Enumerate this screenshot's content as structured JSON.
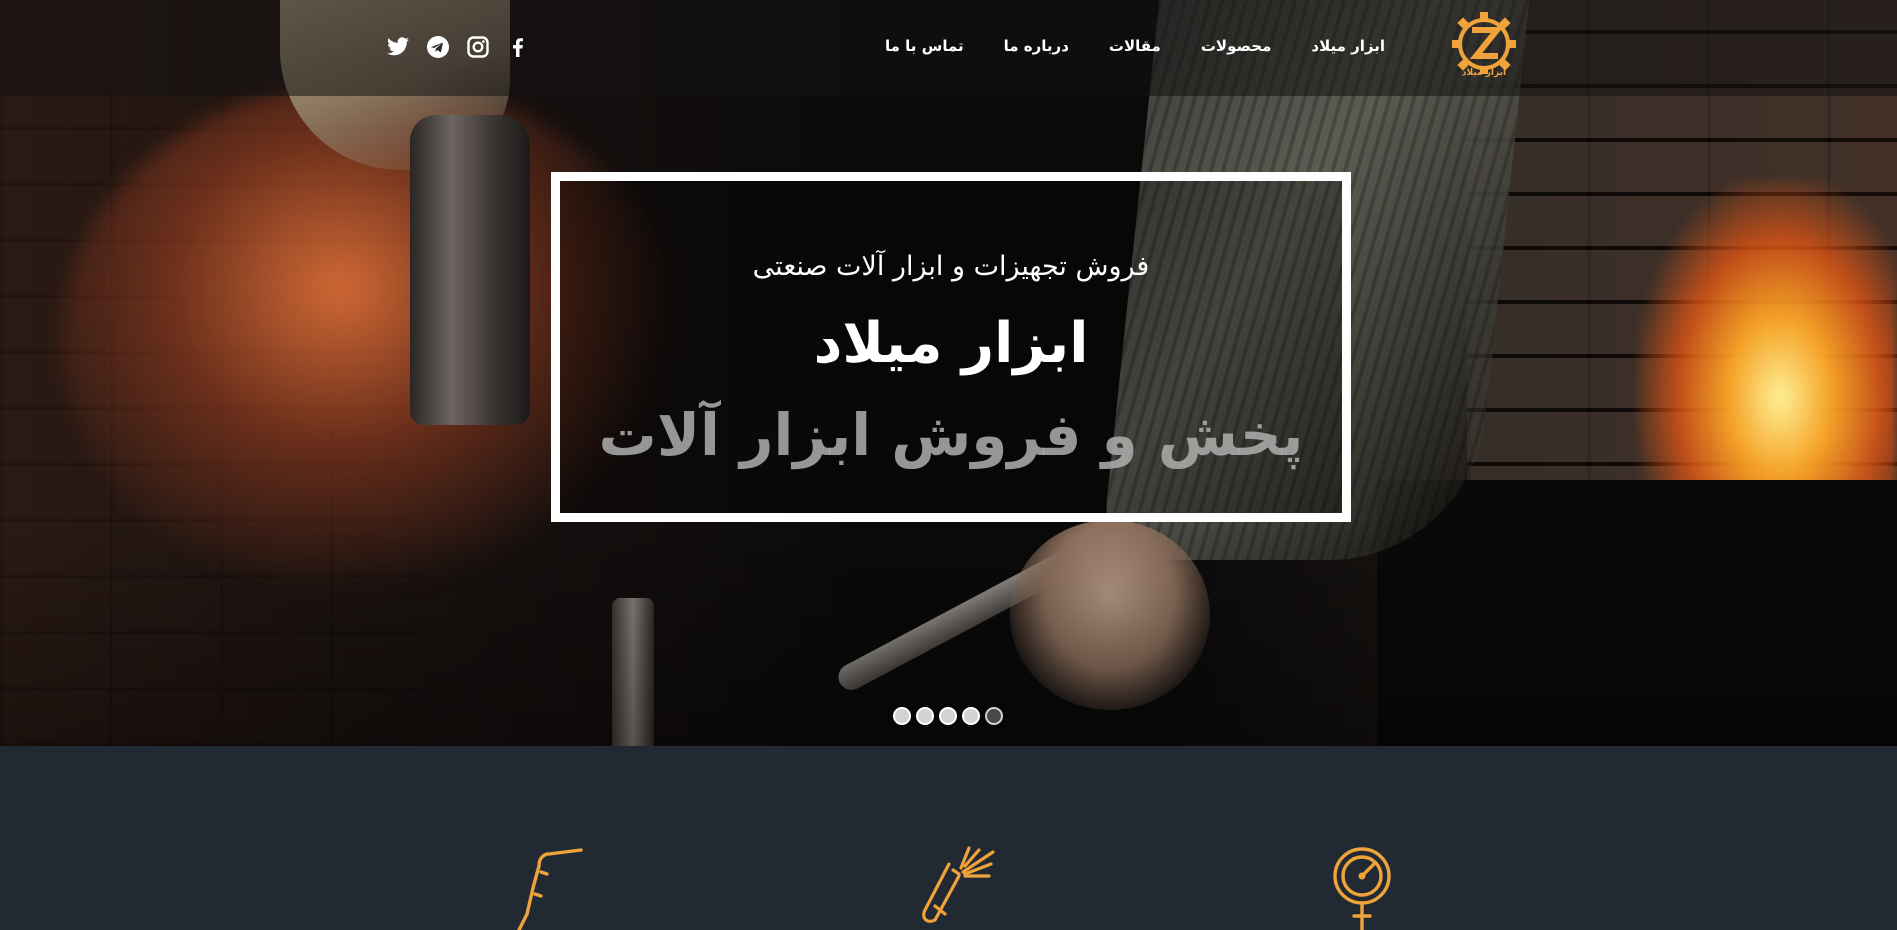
{
  "header": {
    "logo_text": "ابزار میلاد",
    "nav": [
      {
        "label": "ابزار میلاد"
      },
      {
        "label": "محصولات"
      },
      {
        "label": "مقالات"
      },
      {
        "label": "درباره ما"
      },
      {
        "label": "تماس با ما"
      }
    ],
    "social_icons": [
      "facebook-icon",
      "instagram-icon",
      "telegram-icon",
      "twitter-icon"
    ]
  },
  "hero": {
    "subtitle": "فروش تجهیزات و ابزار آلات صنعتی",
    "title": "ابزار میلاد",
    "tagline": "پخش و فروش ابزار آلات",
    "slides_count": 5,
    "active_slide": 5
  },
  "services": {
    "icons": [
      "welding-torch-icon",
      "welding-spark-icon",
      "pressure-gauge-icon"
    ]
  },
  "colors": {
    "accent": "#f0a23b",
    "dark_bg": "#212a33",
    "white": "#ffffff"
  }
}
